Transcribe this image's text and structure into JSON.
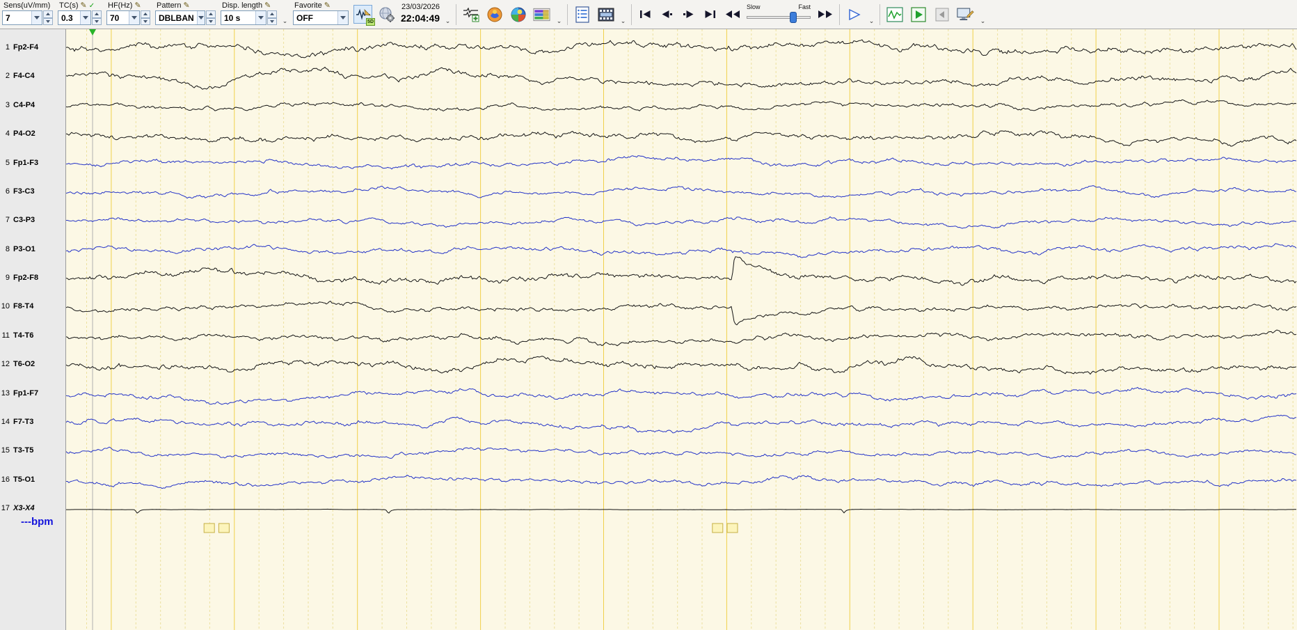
{
  "toolbar": {
    "sens_label": "Sens(uV/mm)",
    "sens_value": "7",
    "tc_label": "TC(s)",
    "tc_value": "0.3",
    "hf_label": "HF(Hz)",
    "hf_value": "70",
    "pattern_label": "Pattern",
    "pattern_value": "DBLBAN",
    "displen_label": "Disp. length",
    "displen_value": "10 s",
    "favorite_label": "Favorite",
    "favorite_value": "OFF",
    "date": "23/03/2026",
    "time": "22:04:49",
    "slow_label": "Slow",
    "fast_label": "Fast",
    "badge_5d": "5D"
  },
  "icons": {
    "pencil": "✎",
    "check": "✓",
    "chevron": "⌄"
  },
  "bpm": "---bpm",
  "channels": [
    {
      "num": "1",
      "label": "Fp2-F4",
      "color": "black",
      "amp": 1.1,
      "hf": 1.5
    },
    {
      "num": "2",
      "label": "F4-C4",
      "color": "black",
      "amp": 1.1,
      "hf": 1.0
    },
    {
      "num": "3",
      "label": "C4-P4",
      "color": "black",
      "amp": 0.8,
      "hf": 0.9
    },
    {
      "num": "4",
      "label": "P4-O2",
      "color": "black",
      "amp": 1.05,
      "hf": 1.0
    },
    {
      "num": "5",
      "label": "Fp1-F3",
      "color": "blue",
      "amp": 0.85,
      "hf": 0.8
    },
    {
      "num": "6",
      "label": "F3-C3",
      "color": "blue",
      "amp": 0.8,
      "hf": 0.8
    },
    {
      "num": "7",
      "label": "C3-P3",
      "color": "blue",
      "amp": 0.8,
      "hf": 0.8
    },
    {
      "num": "8",
      "label": "P3-O1",
      "color": "blue",
      "amp": 0.9,
      "hf": 0.8
    },
    {
      "num": "9",
      "label": "Fp2-F8",
      "color": "black",
      "amp": 1.0,
      "hf": 1.6
    },
    {
      "num": "10",
      "label": "F8-T4",
      "color": "black",
      "amp": 0.9,
      "hf": 1.0
    },
    {
      "num": "11",
      "label": "T4-T6",
      "color": "black",
      "amp": 0.95,
      "hf": 1.0
    },
    {
      "num": "12",
      "label": "T6-O2",
      "color": "black",
      "amp": 1.15,
      "hf": 1.0
    },
    {
      "num": "13",
      "label": "Fp1-F7",
      "color": "blue",
      "amp": 0.9,
      "hf": 0.9
    },
    {
      "num": "14",
      "label": "F7-T3",
      "color": "blue",
      "amp": 0.95,
      "hf": 0.8
    },
    {
      "num": "15",
      "label": "T3-T5",
      "color": "blue",
      "amp": 0.8,
      "hf": 0.9
    },
    {
      "num": "16",
      "label": "T5-O1",
      "color": "blue",
      "amp": 0.85,
      "hf": 0.9
    },
    {
      "num": "17",
      "label": "X3-X4",
      "color": "black",
      "amp": 0.05,
      "hf": 0.3,
      "italic": true
    }
  ],
  "events": [
    {
      "ch": 2,
      "type": "slow",
      "x": 0.112,
      "amp": 15,
      "w": 48
    },
    {
      "ch": 2,
      "type": "slow",
      "x": 0.182,
      "amp": -7,
      "w": 40
    },
    {
      "ch": 9,
      "type": "spike",
      "x": 0.543,
      "amp": -34,
      "decay": 85
    },
    {
      "ch": 10,
      "type": "spike",
      "x": 0.543,
      "amp": 26,
      "decay": 60
    },
    {
      "ch": 17,
      "type": "spike",
      "x": 0.058,
      "amp": 6,
      "decay": 3
    },
    {
      "ch": 17,
      "type": "spike",
      "x": 0.262,
      "amp": 6,
      "decay": 3
    },
    {
      "ch": 17,
      "type": "spike",
      "x": 0.632,
      "amp": 5,
      "decay": 3
    }
  ],
  "event_markers": [
    {
      "x": 0.116
    },
    {
      "x": 0.128
    },
    {
      "x": 0.529
    },
    {
      "x": 0.541
    }
  ],
  "cursor": {
    "x": 0.0215
  },
  "grid": {
    "seconds": 10,
    "phase": 0.367
  },
  "colors": {
    "trace_black": "#141414",
    "trace_blue": "#2433c8",
    "bg": "#fcf8e5",
    "grid_major": "#f0d04a",
    "grid_minor": "#ece09e",
    "bpm_blue": "#1414dc",
    "cursor_gray": "#b0b0b0",
    "marker_fill": "#fcf4bb",
    "marker_stroke": "#c6b046",
    "cursor_green": "#28b428"
  }
}
